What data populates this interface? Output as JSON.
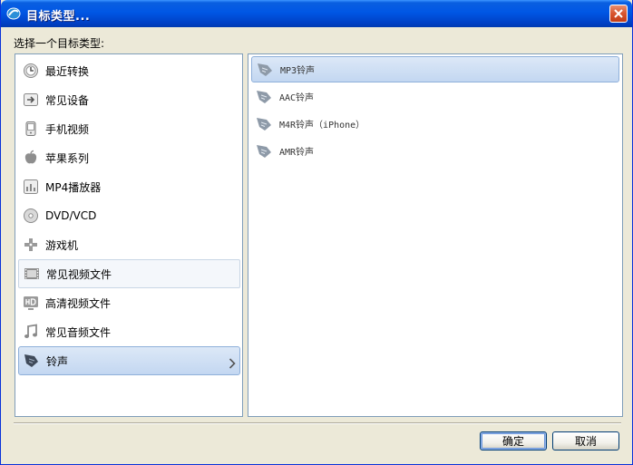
{
  "window": {
    "title": "目标类型..."
  },
  "prompt": "选择一个目标类型:",
  "categories": [
    {
      "label": "最近转换",
      "icon": "clock-icon"
    },
    {
      "label": "常见设备",
      "icon": "device-arrow-icon"
    },
    {
      "label": "手机视频",
      "icon": "phone-icon"
    },
    {
      "label": "苹果系列",
      "icon": "apple-icon"
    },
    {
      "label": "MP4播放器",
      "icon": "mp4-player-icon"
    },
    {
      "label": "DVD/VCD",
      "icon": "disc-icon"
    },
    {
      "label": "游戏机",
      "icon": "gamepad-icon"
    },
    {
      "label": "常见视频文件",
      "icon": "film-icon"
    },
    {
      "label": "高清视频文件",
      "icon": "hd-icon"
    },
    {
      "label": "常见音频文件",
      "icon": "music-note-icon"
    },
    {
      "label": "铃声",
      "icon": "ringtone-icon"
    }
  ],
  "formats": [
    {
      "label": "MP3铃声",
      "icon": "ringtone-icon"
    },
    {
      "label": "AAC铃声",
      "icon": "ringtone-icon"
    },
    {
      "label": "M4R铃声（iPhone）",
      "icon": "ringtone-icon"
    },
    {
      "label": "AMR铃声",
      "icon": "ringtone-icon"
    }
  ],
  "buttons": {
    "ok": "确定",
    "cancel": "取消"
  }
}
